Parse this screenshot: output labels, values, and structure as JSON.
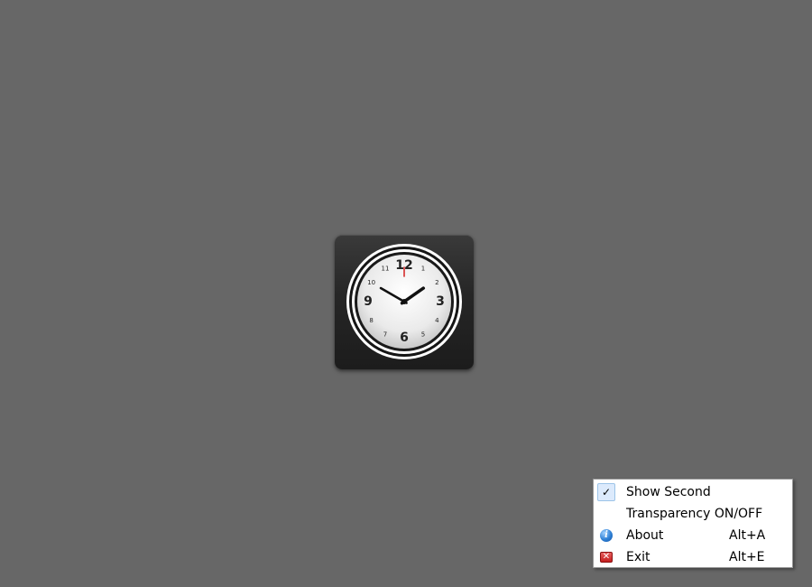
{
  "clock": {
    "numerals": [
      "12",
      "1",
      "2",
      "3",
      "4",
      "5",
      "6",
      "7",
      "8",
      "9",
      "10",
      "11"
    ],
    "time": {
      "hour": 1,
      "minute": 50,
      "second": 0
    },
    "colors": {
      "bezel": "#262626",
      "dial": "#eeeeee",
      "second_hand": "#d32020",
      "hands": "#111111"
    }
  },
  "context_menu": {
    "items": [
      {
        "label": "Show Second",
        "shortcut": "",
        "icon": "check-icon",
        "checked": true
      },
      {
        "label": "Transparency ON/OFF",
        "shortcut": "",
        "icon": "",
        "checked": false
      },
      {
        "label": "About",
        "shortcut": "Alt+A",
        "icon": "info-icon",
        "checked": false
      },
      {
        "label": "Exit",
        "shortcut": "Alt+E",
        "icon": "exit-icon",
        "checked": false
      }
    ],
    "check_glyph": "✓",
    "info_glyph": "i",
    "exit_glyph": "✕"
  }
}
